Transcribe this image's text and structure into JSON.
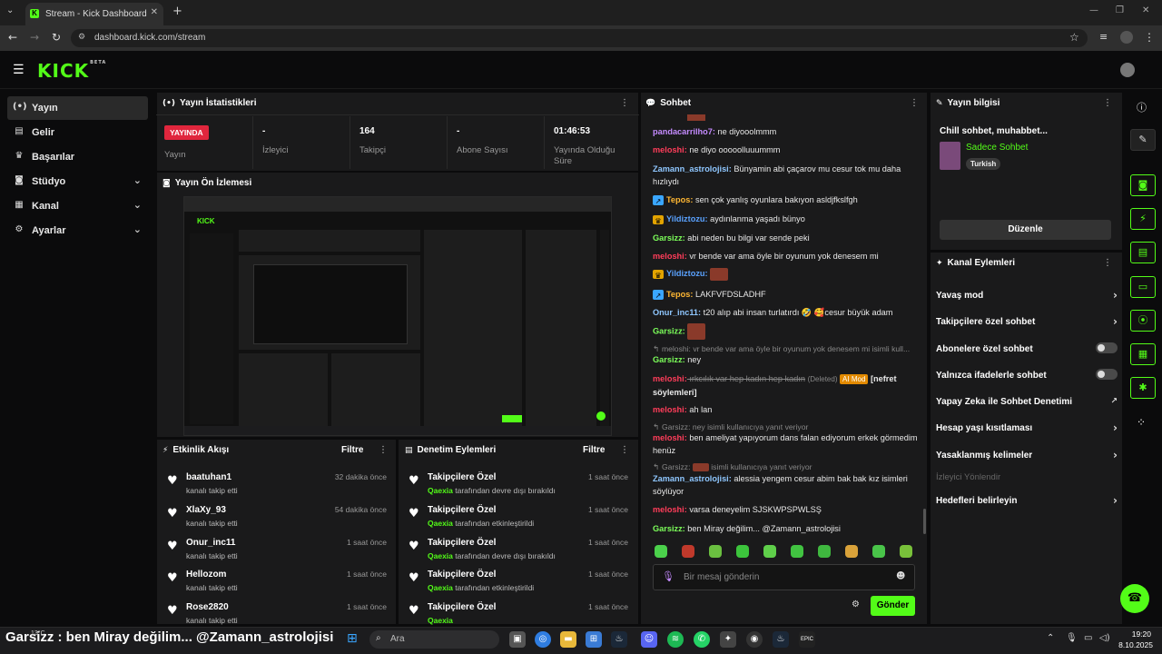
{
  "browser": {
    "tab_title": "Stream - Kick Dashboard",
    "url": "dashboard.kick.com/stream"
  },
  "header": {
    "logo": "KICK",
    "logo_tag": "BETA"
  },
  "sidebar": {
    "items": [
      {
        "label": "Yayın",
        "icon": "broadcast-icon"
      },
      {
        "label": "Gelir",
        "icon": "revenue-icon"
      },
      {
        "label": "Başarılar",
        "icon": "trophy-icon"
      },
      {
        "label": "Stüdyo",
        "icon": "studio-icon"
      },
      {
        "label": "Kanal",
        "icon": "channel-icon"
      },
      {
        "label": "Ayarlar",
        "icon": "gear-icon"
      }
    ]
  },
  "stats": {
    "title": "Yayın İstatistikleri",
    "live_badge": "YAYINDA",
    "live_label": "Yayın",
    "viewers_value": "-",
    "viewers_label": "İzleyici",
    "followers_value": "164",
    "followers_label": "Takipçi",
    "subs_value": "-",
    "subs_label": "Abone Sayısı",
    "uptime_value": "01:46:53",
    "uptime_label": "Yayında Olduğu Süre"
  },
  "preview": {
    "title": "Yayın Ön İzlemesi"
  },
  "activity": {
    "title": "Etkinlik Akışı",
    "filter": "Filtre",
    "items": [
      {
        "name": "baatuhan1",
        "sub": "kanalı takip etti",
        "time": "32 dakika önce"
      },
      {
        "name": "XlaXy_93",
        "sub": "kanalı takip etti",
        "time": "54 dakika önce"
      },
      {
        "name": "Onur_inc11",
        "sub": "kanalı takip etti",
        "time": "1 saat önce"
      },
      {
        "name": "Hellozom",
        "sub": "kanalı takip etti",
        "time": "1 saat önce"
      },
      {
        "name": "Rose2820",
        "sub": "kanalı takip etti",
        "time": "1 saat önce"
      }
    ]
  },
  "moderation": {
    "title": "Denetim Eylemleri",
    "filter": "Filtre",
    "items": [
      {
        "name": "Takipçilere Özel",
        "actor": "Qaexia",
        "sub": " tarafından devre dışı bırakıldı",
        "time": "1 saat önce"
      },
      {
        "name": "Takipçilere Özel",
        "actor": "Qaexia",
        "sub": " tarafından etkinleştirildi",
        "time": "1 saat önce"
      },
      {
        "name": "Takipçilere Özel",
        "actor": "Qaexia",
        "sub": " tarafından devre dışı bırakıldı",
        "time": "1 saat önce"
      },
      {
        "name": "Takipçilere Özel",
        "actor": "Qaexia",
        "sub": " tarafından etkinleştirildi",
        "time": "1 saat önce"
      },
      {
        "name": "Takipçilere Özel",
        "actor": "Qaexia",
        "sub": "",
        "time": "1 saat önce"
      }
    ]
  },
  "chat": {
    "title": "Sohbet",
    "placeholder": "Bir mesaj gönderin",
    "send": "Gönder",
    "m1_user": "pandacarrilho7:",
    "m1_text": " ne diyooolmmm",
    "m2_user": "meloshi:",
    "m2_text": " ne diyo ooooolluuummm",
    "m3_user": "Zamann_astrolojisi:",
    "m3_text": " Bünyamin abi çaçarov mu cesur tok mu daha hızlıydı",
    "m4_user": "Tepos:",
    "m4_text": " sen çok yanlış oyunlara bakıyon asldjfkslfgh",
    "m5_user": "Yildiztozu:",
    "m5_text": " aydınlanma yaşadı bünyo",
    "m6_user": "Garsizz:",
    "m6_text": " abi neden bu bilgi var sende peki",
    "m7_user": "meloshi:",
    "m7_text": " vr bende var ama öyle bir oyunum yok denesem mi",
    "m8_user": "Yildiztozu:",
    "m9_user": "Tepos:",
    "m9_text": " LAKFVFDSLADHF",
    "m10_user": "Onur_inc11:",
    "m10_text": " t20 alıp abi insan turlatırdı 🤣 🥰cesur büyük adam",
    "m11_user": "Garsizz:",
    "m12_reply": "meloshi: vr bende var ama öyle bir oyunum yok denesem mi isimli kull...",
    "m12_user": "Garsizz:",
    "m12_text": " ney",
    "m13_user": "meloshi:",
    "m13_deleted": " ırkcılık var hep kadın hep kadın",
    "m13_tag": "(Deleted)",
    "m13_mod": "AI Mod",
    "m13_reason": "[nefret söylemleri]",
    "m14_user": "meloshi:",
    "m14_text": " ah lan",
    "m15_reply": "Garsizz: ney isimli kullanıcıya yanıt veriyor",
    "m15_user": "meloshi:",
    "m15_text": " ben ameliyat yapıyorum dans falan ediyorum erkek görmedim henüz",
    "m16_reply_a": "Garsizz:",
    "m16_reply_b": "isimli kullanıcıya yanıt veriyor",
    "m16_user": "Zamann_astrolojisi:",
    "m16_text": " alessia yengem cesur abim bak bak kız isimleri söylüyor",
    "m17_user": "meloshi:",
    "m17_text": " varsa deneyelim SJSKWPSPWLSŞ",
    "m18_user": "Garsizz:",
    "m18_text": " ben Miray değilim... @Zamann_astrolojisi"
  },
  "stream_info": {
    "title": "Yayın bilgisi",
    "stream_title": "Chill sohbet, muhabbet...",
    "category": "Sadece Sohbet",
    "tag": "Turkish",
    "edit": "Düzenle"
  },
  "channel_actions": {
    "title": "Kanal Eylemleri",
    "slow": "Yavaş mod",
    "followers": "Takipçilere özel sohbet",
    "subs": "Abonelere özel sohbet",
    "emotes": "Yalnızca ifadelerle sohbet",
    "ai": "Yapay Zeka ile Sohbet Denetimi",
    "age": "Hesap yaşı kısıtlaması",
    "banned": "Yasaklanmış kelimeler",
    "viewer_guide": "İzleyici Yönlendir",
    "goals": "Hedefleri belirleyin"
  },
  "ticker": {
    "text": "Garsizz : ben Miray değilim... @Zamann_astrolojisi"
  },
  "taskbar": {
    "search": "Ara",
    "weather": "13°C",
    "time": "19:20",
    "date": "8.10.2025"
  },
  "colors": {
    "accent": "#53fc18",
    "panel": "#1a1a1b",
    "live": "#e0263d"
  }
}
